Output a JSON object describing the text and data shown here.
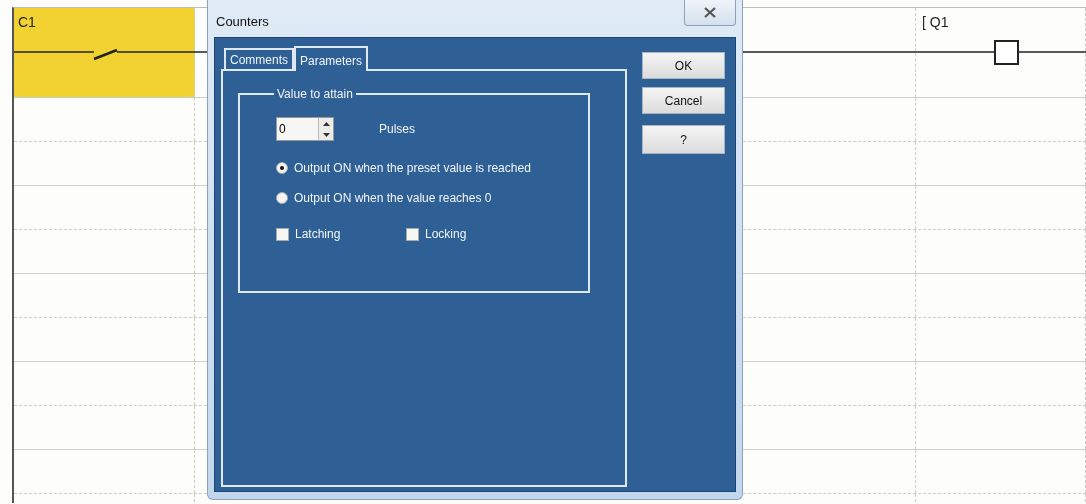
{
  "ladder": {
    "contact": {
      "label": "C1",
      "selected": true
    },
    "coil": {
      "label": "[ Q1"
    }
  },
  "dialog": {
    "title": "Counters",
    "tabs": [
      {
        "label": "Comments",
        "selected": false
      },
      {
        "label": "Parameters",
        "selected": true
      }
    ],
    "group_title": "Value to attain",
    "pulses": {
      "value": "0",
      "unit": "Pulses"
    },
    "radios": [
      {
        "label": "Output ON when the preset value is reached",
        "selected": true
      },
      {
        "label": "Output ON when the value reaches 0",
        "selected": false
      }
    ],
    "checkboxes": [
      {
        "label": "Latching",
        "checked": false
      },
      {
        "label": "Locking",
        "checked": false
      }
    ],
    "buttons": [
      "OK",
      "Cancel",
      "?"
    ]
  }
}
